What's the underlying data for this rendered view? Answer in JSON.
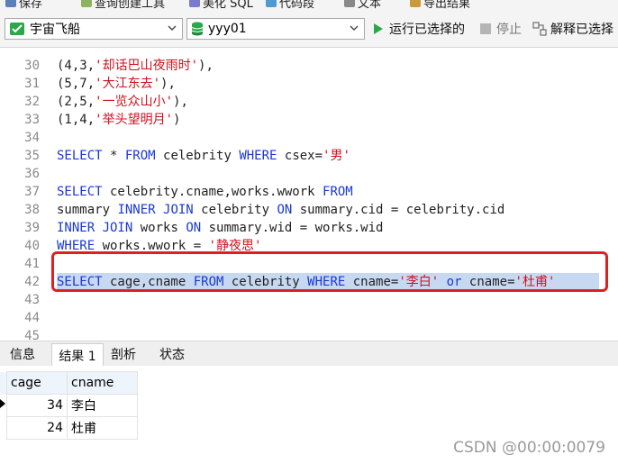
{
  "toolbar": {
    "items": [
      "保存",
      "查询创建工具",
      "美化 SQL",
      "代码段",
      "文本",
      "导出结果"
    ]
  },
  "querybar": {
    "connection": "宇宙飞船",
    "database": "yyy01",
    "run_selected": "运行已选择的",
    "stop": "停止",
    "explain": "解释已选择"
  },
  "editor": {
    "lines": [
      {
        "n": "30",
        "tokens": [
          {
            "t": "(4,3,",
            "c": "p"
          },
          {
            "t": "'却话巴山夜雨时'",
            "c": "s"
          },
          {
            "t": "),",
            "c": "p"
          }
        ]
      },
      {
        "n": "31",
        "tokens": [
          {
            "t": "(5,7,",
            "c": "p"
          },
          {
            "t": "'大江东去'",
            "c": "s"
          },
          {
            "t": "),",
            "c": "p"
          }
        ]
      },
      {
        "n": "32",
        "tokens": [
          {
            "t": "(2,5,",
            "c": "p"
          },
          {
            "t": "'一览众山小'",
            "c": "s"
          },
          {
            "t": "),",
            "c": "p"
          }
        ]
      },
      {
        "n": "33",
        "tokens": [
          {
            "t": "(1,4,",
            "c": "p"
          },
          {
            "t": "'举头望明月'",
            "c": "s"
          },
          {
            "t": ")",
            "c": "p"
          }
        ]
      },
      {
        "n": "34",
        "tokens": []
      },
      {
        "n": "35",
        "tokens": [
          {
            "t": "SELECT",
            "c": "k"
          },
          {
            "t": " * ",
            "c": "p"
          },
          {
            "t": "FROM",
            "c": "k"
          },
          {
            "t": " celebrity ",
            "c": "p"
          },
          {
            "t": "WHERE",
            "c": "k"
          },
          {
            "t": " csex=",
            "c": "p"
          },
          {
            "t": "'男'",
            "c": "s"
          }
        ]
      },
      {
        "n": "36",
        "tokens": []
      },
      {
        "n": "37",
        "tokens": [
          {
            "t": "SELECT",
            "c": "k"
          },
          {
            "t": " celebrity.cname,works.wwork ",
            "c": "p"
          },
          {
            "t": "FROM",
            "c": "k"
          }
        ]
      },
      {
        "n": "38",
        "tokens": [
          {
            "t": "summary ",
            "c": "p"
          },
          {
            "t": "INNER JOIN",
            "c": "k"
          },
          {
            "t": " celebrity ",
            "c": "p"
          },
          {
            "t": "ON",
            "c": "k"
          },
          {
            "t": " summary.cid = celebrity.cid",
            "c": "p"
          }
        ]
      },
      {
        "n": "39",
        "tokens": [
          {
            "t": "INNER JOIN",
            "c": "k"
          },
          {
            "t": " works ",
            "c": "p"
          },
          {
            "t": "ON",
            "c": "k"
          },
          {
            "t": " summary.wid = works.wid",
            "c": "p"
          }
        ]
      },
      {
        "n": "40",
        "tokens": [
          {
            "t": "WHERE",
            "c": "k"
          },
          {
            "t": " works.wwork = ",
            "c": "p"
          },
          {
            "t": "'静夜思'",
            "c": "s"
          }
        ]
      },
      {
        "n": "41",
        "tokens": []
      },
      {
        "n": "42",
        "tokens": [
          {
            "t": "SELECT",
            "c": "k"
          },
          {
            "t": " cage,cname ",
            "c": "p"
          },
          {
            "t": "FROM",
            "c": "k"
          },
          {
            "t": " celebrity ",
            "c": "p"
          },
          {
            "t": "WHERE",
            "c": "k"
          },
          {
            "t": " cname=",
            "c": "p"
          },
          {
            "t": "'李白'",
            "c": "s"
          },
          {
            "t": " ",
            "c": "p"
          },
          {
            "t": "or",
            "c": "k"
          },
          {
            "t": " cname=",
            "c": "p"
          },
          {
            "t": "'杜甫'",
            "c": "s"
          }
        ],
        "selected": true
      },
      {
        "n": "43",
        "tokens": []
      },
      {
        "n": "44",
        "tokens": []
      },
      {
        "n": "45",
        "tokens": []
      }
    ]
  },
  "tabs": [
    "信息",
    "结果 1",
    "剖析",
    "状态"
  ],
  "active_tab": "结果 1",
  "results": {
    "columns": [
      "cage",
      "cname"
    ],
    "rows": [
      [
        "34",
        "李白"
      ],
      [
        "24",
        "杜甫"
      ]
    ]
  },
  "watermark": "CSDN @00:00:0079",
  "colors": {
    "keyword": "#1a37d6",
    "string": "#d0101c",
    "highlight_box": "#e02020",
    "selection": "#c7d9f1"
  }
}
